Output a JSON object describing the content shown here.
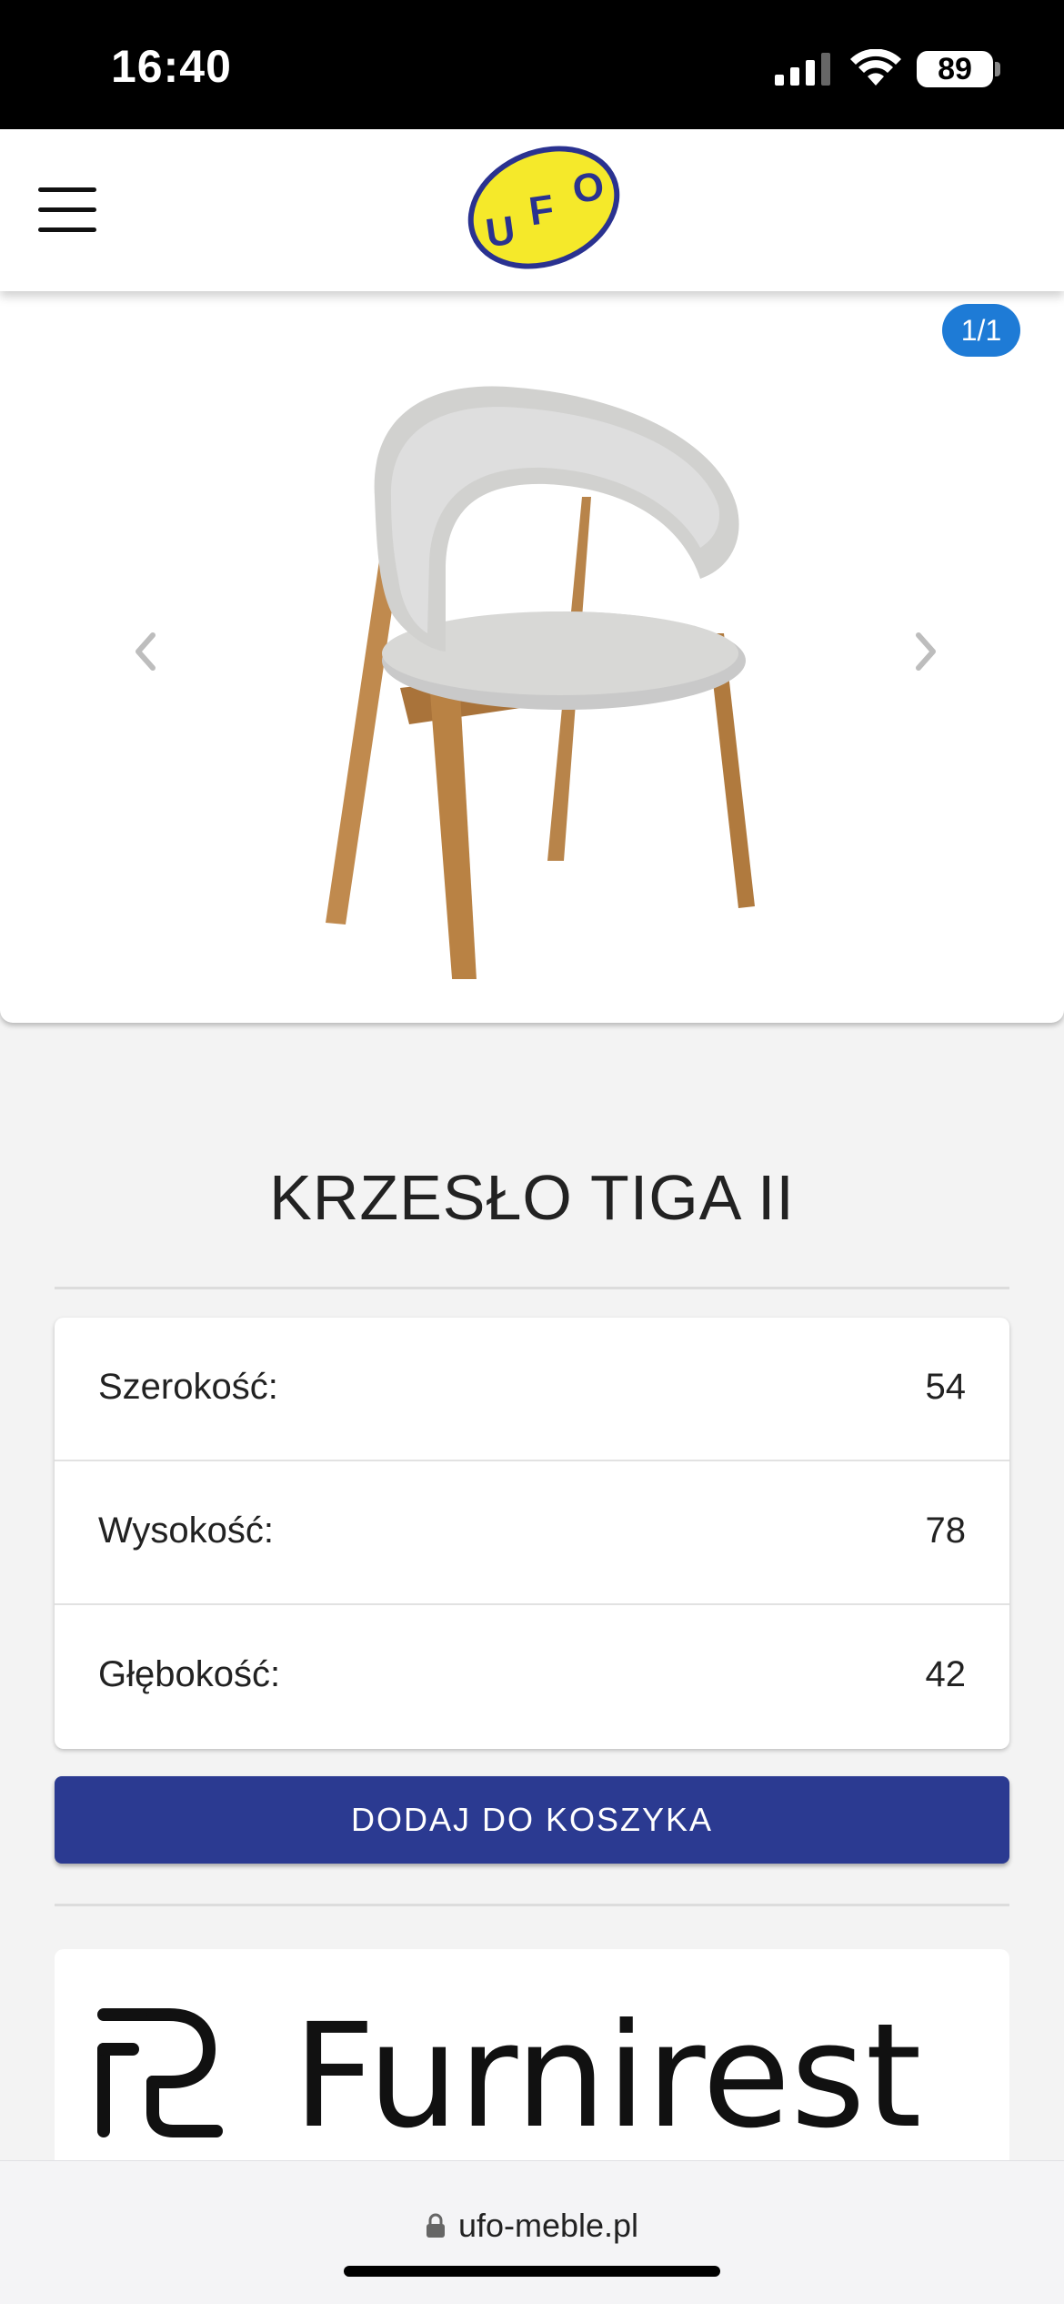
{
  "status_bar": {
    "time": "16:40",
    "battery": "89"
  },
  "header": {
    "logo_text": "UFO"
  },
  "gallery": {
    "counter": "1/1"
  },
  "product": {
    "title": "KRZESŁO TIGA II",
    "specs": [
      {
        "label": "Szerokość:",
        "value": "54"
      },
      {
        "label": "Wysokość:",
        "value": "78"
      },
      {
        "label": "Głębokość:",
        "value": "42"
      }
    ],
    "add_to_cart_label": "DODAJ DO KOSZYKA"
  },
  "brand": {
    "name": "Furnirest"
  },
  "browser": {
    "url": "ufo-meble.pl"
  },
  "colors": {
    "accent_blue": "#1e7bd6",
    "cart_button": "#2b3a91",
    "logo_yellow": "#f5e92a",
    "logo_navy": "#2a3290"
  }
}
